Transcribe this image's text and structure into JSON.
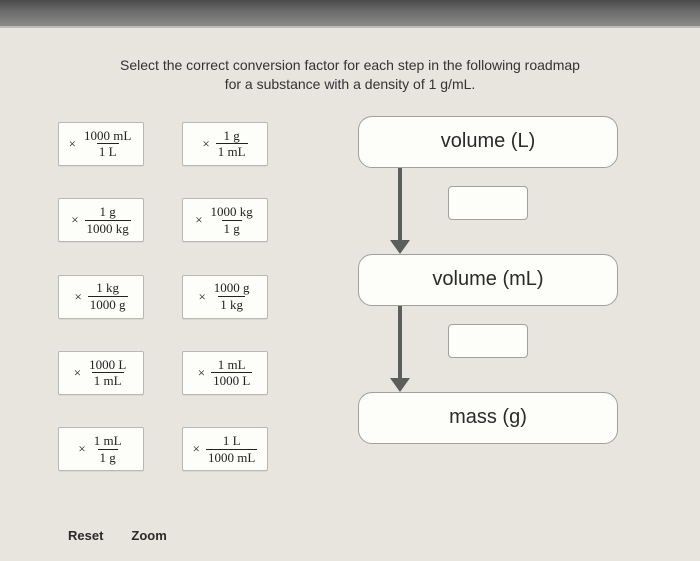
{
  "instructions": {
    "line1": "Select the correct conversion factor for each step in the following roadmap",
    "line2": "for a substance with a density of 1 g/mL."
  },
  "tiles": [
    {
      "num": "1000 mL",
      "den": "1 L"
    },
    {
      "num": "1 g",
      "den": "1 mL"
    },
    {
      "num": "1 g",
      "den": "1000 kg"
    },
    {
      "num": "1000 kg",
      "den": "1 g"
    },
    {
      "num": "1 kg",
      "den": "1000 g"
    },
    {
      "num": "1000 g",
      "den": "1 kg"
    },
    {
      "num": "1000 L",
      "den": "1 mL"
    },
    {
      "num": "1 mL",
      "den": "1000 L"
    },
    {
      "num": "1 mL",
      "den": "1 g"
    },
    {
      "num": "1 L",
      "den": "1000 mL"
    }
  ],
  "roadmap": {
    "node1": "volume (L)",
    "node2": "volume (mL)",
    "node3": "mass (g)"
  },
  "controls": {
    "reset": "Reset",
    "zoom": "Zoom"
  },
  "chart_data": {
    "type": "diagram",
    "description": "Unit conversion roadmap with two drop slots between three nodes",
    "nodes": [
      "volume (L)",
      "volume (mL)",
      "mass (g)"
    ],
    "slots": 2,
    "density": "1 g/mL",
    "available_factors": [
      "× 1000 mL / 1 L",
      "× 1 g / 1 mL",
      "× 1 g / 1000 kg",
      "× 1000 kg / 1 g",
      "× 1 kg / 1000 g",
      "× 1000 g / 1 kg",
      "× 1000 L / 1 mL",
      "× 1 mL / 1000 L",
      "× 1 mL / 1 g",
      "× 1 L / 1000 mL"
    ]
  }
}
